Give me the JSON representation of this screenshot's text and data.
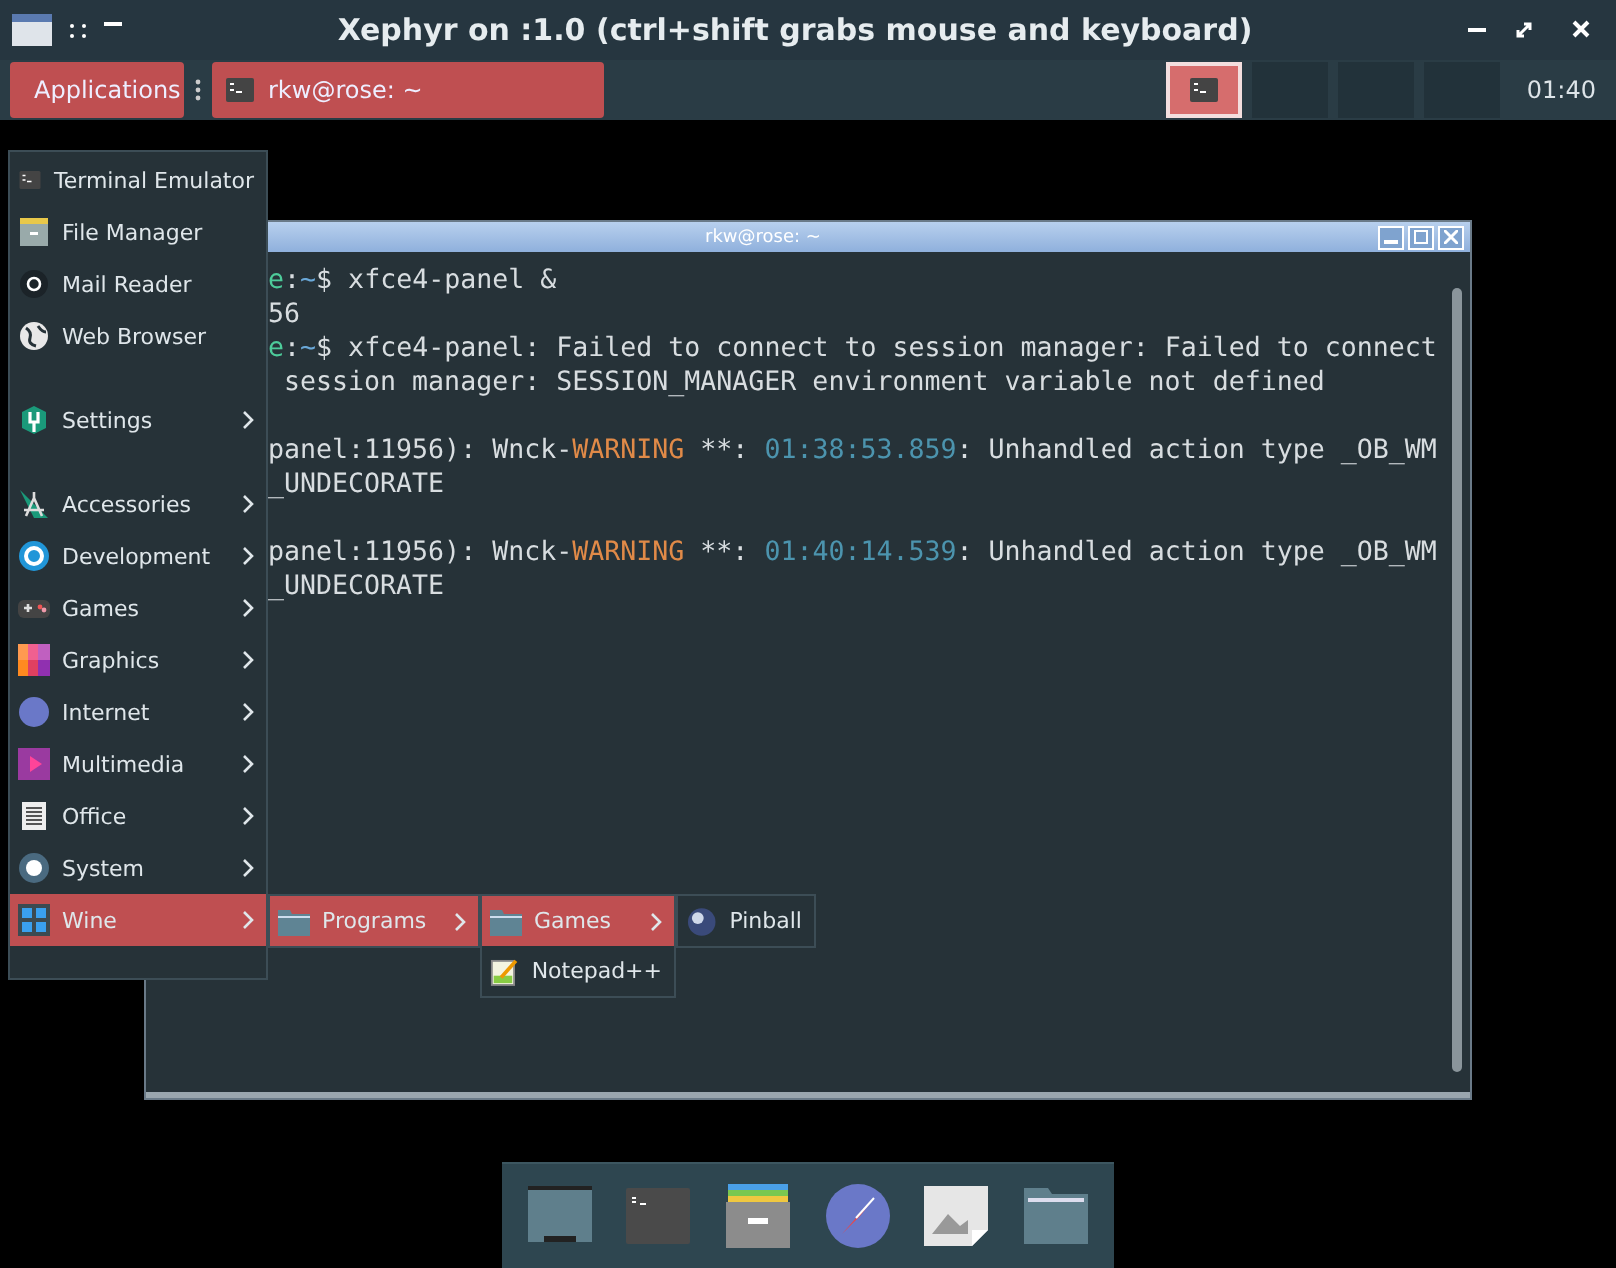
{
  "window": {
    "title": "Xephyr on :1.0 (ctrl+shift grabs mouse and keyboard)"
  },
  "panel": {
    "applications": {
      "label": "Applications",
      "selected": true
    },
    "tasks": [
      {
        "label": "rkw@rose: ~",
        "selected": true
      }
    ],
    "workspaces": [
      {
        "selected": true
      },
      {
        "selected": false
      },
      {
        "selected": false
      },
      {
        "selected": false
      }
    ],
    "clock": "01:40"
  },
  "terminal": {
    "title": "rkw@rose: ~",
    "blocks": [
      [
        [
          {
            "kind": "host",
            "text": "e"
          },
          {
            "kind": "plain",
            "text": ":"
          },
          {
            "kind": "path",
            "text": "~"
          },
          {
            "kind": "plain",
            "text": "$ xfce4-panel &"
          }
        ],
        [
          {
            "kind": "plain",
            "text": "56"
          }
        ],
        [
          {
            "kind": "host",
            "text": "e"
          },
          {
            "kind": "plain",
            "text": ":"
          },
          {
            "kind": "path",
            "text": "~"
          },
          {
            "kind": "plain",
            "text": "$ xfce4-panel: Failed to connect to session manager: Failed to connect"
          }
        ],
        [
          {
            "kind": "plain",
            "text": " session manager: SESSION_MANAGER environment variable not defined"
          }
        ]
      ],
      [
        [
          {
            "kind": "plain",
            "text": "panel:11956): Wnck-"
          },
          {
            "kind": "warning",
            "text": "WARNING"
          },
          {
            "kind": "plain",
            "text": " **: "
          },
          {
            "kind": "time",
            "text": "01:38:53.859"
          },
          {
            "kind": "plain",
            "text": ": Unhandled action type _OB_WM"
          }
        ],
        [
          {
            "kind": "plain",
            "text": "_UNDECORATE"
          }
        ]
      ],
      [
        [
          {
            "kind": "plain",
            "text": "panel:11956): Wnck-"
          },
          {
            "kind": "warning",
            "text": "WARNING"
          },
          {
            "kind": "plain",
            "text": " **: "
          },
          {
            "kind": "time",
            "text": "01:40:14.539"
          },
          {
            "kind": "plain",
            "text": ": Unhandled action type _OB_WM"
          }
        ],
        [
          {
            "kind": "plain",
            "text": "_UNDECORATE"
          }
        ]
      ]
    ]
  },
  "menu": {
    "groups": [
      [
        {
          "label": "Terminal Emulator",
          "submenu": false,
          "selected": false
        },
        {
          "label": "File Manager",
          "submenu": false,
          "selected": false
        },
        {
          "label": "Mail Reader",
          "submenu": false,
          "selected": false
        },
        {
          "label": "Web Browser",
          "submenu": false,
          "selected": false
        }
      ],
      [
        {
          "label": "Settings",
          "submenu": true,
          "selected": false
        }
      ],
      [
        {
          "label": "Accessories",
          "submenu": true,
          "selected": false
        },
        {
          "label": "Development",
          "submenu": true,
          "selected": false
        },
        {
          "label": "Games",
          "submenu": true,
          "selected": false
        },
        {
          "label": "Graphics",
          "submenu": true,
          "selected": false
        },
        {
          "label": "Internet",
          "submenu": true,
          "selected": false
        },
        {
          "label": "Multimedia",
          "submenu": true,
          "selected": false
        },
        {
          "label": "Office",
          "submenu": true,
          "selected": false
        },
        {
          "label": "System",
          "submenu": true,
          "selected": false
        },
        {
          "label": "Wine",
          "submenu": true,
          "selected": true
        }
      ]
    ],
    "submenus": [
      {
        "items": [
          {
            "kind": "folder",
            "label": "Programs",
            "submenu": true,
            "selected": true
          }
        ]
      },
      {
        "items": [
          {
            "kind": "folder",
            "label": "Games",
            "submenu": true,
            "selected": true
          },
          {
            "kind": "notepad",
            "label": "Notepad++",
            "submenu": false,
            "selected": false
          }
        ]
      },
      {
        "items": [
          {
            "kind": "ball",
            "label": "Pinball",
            "submenu": false,
            "selected": false
          }
        ]
      }
    ]
  }
}
